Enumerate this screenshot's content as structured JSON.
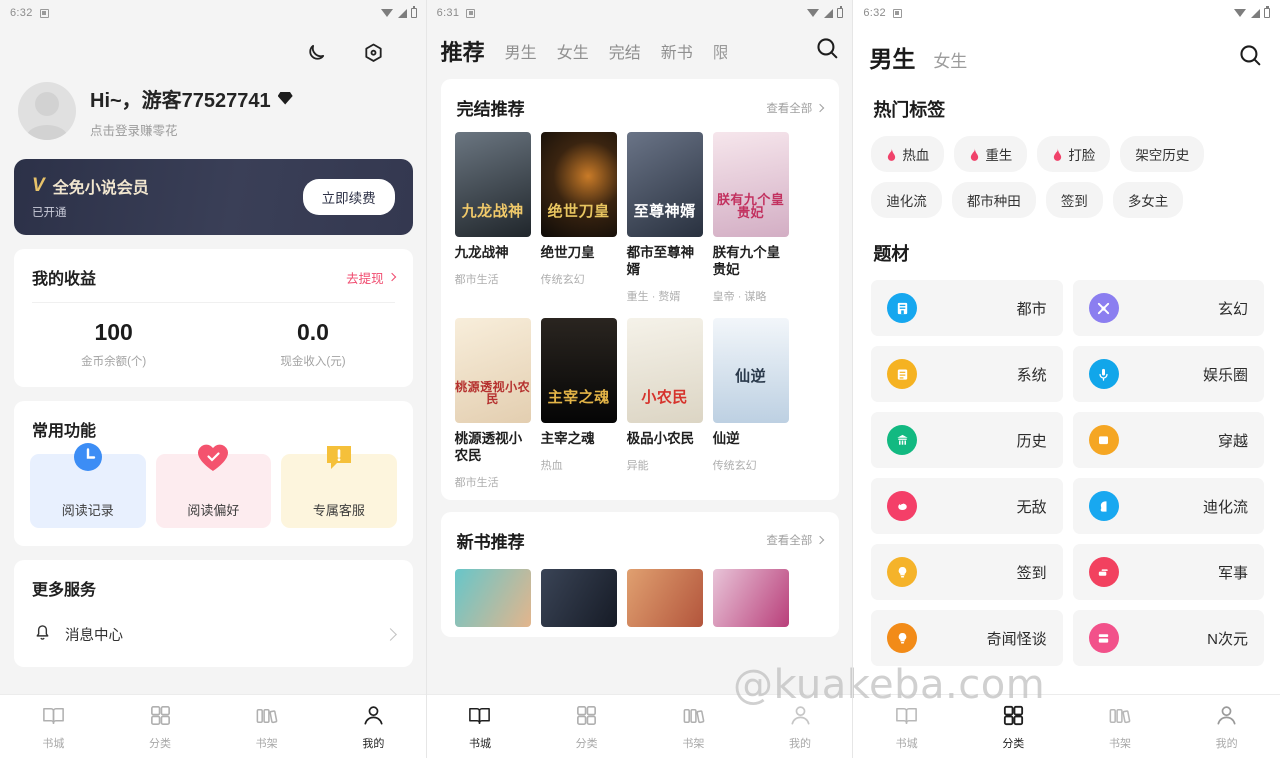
{
  "status_bar": {
    "time_left": "6:32",
    "time_mid": "6:31",
    "time_right": "6:32"
  },
  "watermark": "@kuakeba.com",
  "screen_mine": {
    "icons": {
      "night": "moon-icon",
      "settings": "gear-icon"
    },
    "profile": {
      "name": "Hi~，游客77527741",
      "subtitle": "点击登录赚零花"
    },
    "vip": {
      "logo": "V",
      "title": "全免小说会员",
      "status": "已开通",
      "button": "立即续费"
    },
    "earnings": {
      "title": "我的收益",
      "link": "去提现",
      "stats": [
        {
          "value": "100",
          "label": "金币余额(个)"
        },
        {
          "value": "0.0",
          "label": "现金收入(元)"
        }
      ]
    },
    "functions": {
      "title": "常用功能",
      "items": [
        {
          "label": "阅读记录",
          "icon": "clock-icon",
          "color": "#3c8df5",
          "bg": "#e8f0fe"
        },
        {
          "label": "阅读偏好",
          "icon": "heart-icon",
          "color": "#f4536e",
          "bg": "#fdecef"
        },
        {
          "label": "专属客服",
          "icon": "chat-alert-icon",
          "color": "#f5c03a",
          "bg": "#fdf5dd"
        }
      ]
    },
    "more": {
      "title": "更多服务",
      "items": [
        {
          "label": "消息中心",
          "icon": "bell-icon"
        }
      ]
    },
    "tabbar": [
      {
        "label": "书城",
        "icon": "book-icon",
        "active": false
      },
      {
        "label": "分类",
        "icon": "grid-icon",
        "active": false
      },
      {
        "label": "书架",
        "icon": "shelf-icon",
        "active": false
      },
      {
        "label": "我的",
        "icon": "person-icon",
        "active": true
      }
    ]
  },
  "screen_store": {
    "tabs": [
      {
        "label": "推荐",
        "active": true
      },
      {
        "label": "男生",
        "active": false
      },
      {
        "label": "女生",
        "active": false
      },
      {
        "label": "完结",
        "active": false
      },
      {
        "label": "新书",
        "active": false
      },
      {
        "label": "限",
        "active": false,
        "clipped": true
      }
    ],
    "search_icon": "search-icon",
    "sections": [
      {
        "title": "完结推荐",
        "link": "查看全部",
        "rows": [
          [
            {
              "title": "九龙战神",
              "category": "都市生活",
              "cover_text": "九龙战神",
              "cover_from": "#5b6770",
              "cover_to": "#242b30",
              "cover_color": "#f0c96a"
            },
            {
              "title": "绝世刀皇",
              "category": "传统玄幻",
              "cover_text": "绝世刀皇",
              "cover_from": "#1b1510",
              "cover_to": "#110d0a",
              "cover_color": "#e8c560"
            },
            {
              "title": "都市至尊神婿",
              "category": "重生 · 赘婿",
              "cover_text": "至尊神婿",
              "cover_from": "#3d4a63",
              "cover_to": "#1d2636",
              "cover_color": "#ffffff"
            },
            {
              "title": "朕有九个皇贵妃",
              "category": "皇帝 · 谋略",
              "cover_text": "朕有九个皇贵妃",
              "cover_from": "#f3dfe6",
              "cover_to": "#d9b9cd",
              "cover_color": "#c2315f"
            }
          ],
          [
            {
              "title": "桃源透视小农民",
              "category": "都市生活",
              "cover_text": "桃源透视小农民",
              "cover_from": "#f6ead6",
              "cover_to": "#e8d3b6",
              "cover_color": "#b5312f"
            },
            {
              "title": "主宰之魂",
              "category": "热血",
              "cover_text": "主宰之魂",
              "cover_from": "#141414",
              "cover_to": "#000000",
              "cover_color": "#e3b447"
            },
            {
              "title": "极品小农民",
              "category": "异能",
              "cover_text": "小农民",
              "cover_from": "#f2efe6",
              "cover_to": "#ded8c8",
              "cover_color": "#d6332c"
            },
            {
              "title": "仙逆",
              "category": "传统玄幻",
              "cover_text": "仙逆",
              "cover_from": "#eef3f8",
              "cover_to": "#c6d7e6",
              "cover_color": "#2b3a4c"
            }
          ]
        ]
      },
      {
        "title": "新书推荐",
        "link": "查看全部",
        "thumbs": [
          {
            "from": "#67c6c9",
            "to": "#e3b58c"
          },
          {
            "from": "#3a4456",
            "to": "#161b26"
          },
          {
            "from": "#e0a070",
            "to": "#b3553c"
          },
          {
            "from": "#e8c4d8",
            "to": "#b93f7a"
          }
        ]
      }
    ],
    "tabbar": [
      {
        "label": "书城",
        "icon": "book-icon",
        "active": true
      },
      {
        "label": "分类",
        "icon": "grid-icon",
        "active": false
      },
      {
        "label": "书架",
        "icon": "shelf-icon",
        "active": false
      },
      {
        "label": "我的",
        "icon": "person-icon",
        "active": false
      }
    ]
  },
  "screen_category": {
    "tabs": [
      {
        "label": "男生",
        "active": true
      },
      {
        "label": "女生",
        "active": false
      }
    ],
    "search_icon": "search-icon",
    "hot_tags_title": "热门标签",
    "hot_tags": [
      {
        "label": "热血",
        "hot": true
      },
      {
        "label": "重生",
        "hot": true
      },
      {
        "label": "打脸",
        "hot": true
      },
      {
        "label": "架空历史",
        "hot": false
      },
      {
        "label": "迪化流",
        "hot": false
      },
      {
        "label": "都市种田",
        "hot": false
      },
      {
        "label": "签到",
        "hot": false
      },
      {
        "label": "多女主",
        "hot": false
      }
    ],
    "genre_title": "题材",
    "genres": [
      {
        "label": "都市",
        "color": "#16a7ef",
        "icon": "building-icon"
      },
      {
        "label": "玄幻",
        "color": "#8b7ef0",
        "icon": "sword-icon"
      },
      {
        "label": "系统",
        "color": "#f5b221",
        "icon": "panel-icon"
      },
      {
        "label": "娱乐圈",
        "color": "#11a6ea",
        "icon": "mic-icon"
      },
      {
        "label": "历史",
        "color": "#12b981",
        "icon": "temple-icon"
      },
      {
        "label": "穿越",
        "color": "#f5a623",
        "icon": "portal-icon"
      },
      {
        "label": "无敌",
        "color": "#f43f68",
        "icon": "fist-icon"
      },
      {
        "label": "迪化流",
        "color": "#18a8f0",
        "icon": "head-icon"
      },
      {
        "label": "签到",
        "color": "#f5b32a",
        "icon": "bulb-icon"
      },
      {
        "label": "军事",
        "color": "#f2415f",
        "icon": "tank-icon"
      },
      {
        "label": "奇闻怪谈",
        "color": "#f28b18",
        "icon": "lamp-icon"
      },
      {
        "label": "N次元",
        "color": "#f2518a",
        "icon": "film-icon"
      }
    ],
    "tabbar": [
      {
        "label": "书城",
        "icon": "book-icon",
        "active": false
      },
      {
        "label": "分类",
        "icon": "grid-icon",
        "active": true
      },
      {
        "label": "书架",
        "icon": "shelf-icon",
        "active": false
      },
      {
        "label": "我的",
        "icon": "person-icon",
        "active": false
      }
    ]
  }
}
